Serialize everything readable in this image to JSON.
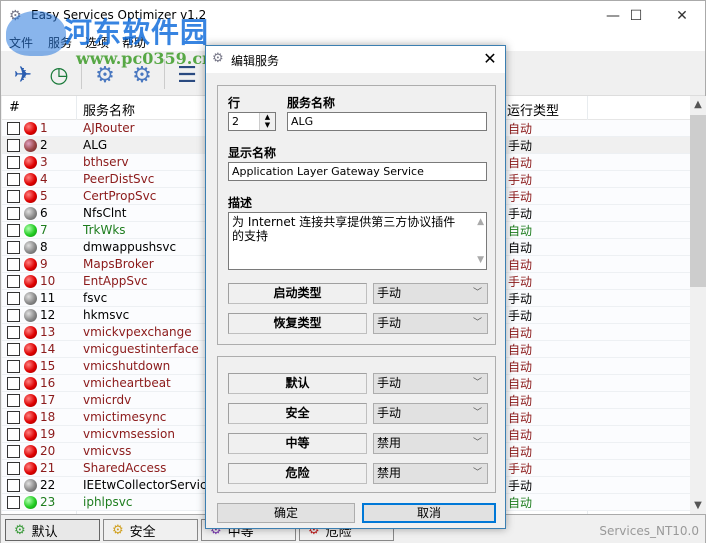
{
  "window": {
    "title": "Easy Services Optimizer v1.2",
    "controls": {
      "minimize": "─",
      "maximize": "☐",
      "close": "✕"
    }
  },
  "watermark": {
    "title": "河东软件园",
    "url": "www.pc0359.cn"
  },
  "menu": [
    "文件",
    "服务",
    "选项",
    "帮助"
  ],
  "toolbar": {
    "buttons": [
      {
        "name": "optimize",
        "icon": "rocket-icon",
        "glyph": "🚀"
      },
      {
        "name": "restore",
        "icon": "restore-clock-icon",
        "glyph": "🕘"
      },
      {
        "name": "start-service",
        "icon": "gear-play-icon",
        "glyph": "⚙"
      },
      {
        "name": "stop-service",
        "icon": "gear-stop-icon",
        "glyph": "⚙"
      },
      {
        "name": "add-service",
        "icon": "list-add-icon",
        "glyph": "☰"
      }
    ]
  },
  "grid": {
    "columns": {
      "num": "#",
      "name": "服务名称",
      "run_type": "运行类型"
    },
    "rows": [
      {
        "num": "1",
        "name": "AJRouter",
        "run_type": "自动",
        "status": "red",
        "color": "red",
        "rtcolor": "red"
      },
      {
        "num": "2",
        "name": "ALG",
        "run_type": "手动",
        "status": "purple",
        "color": "black",
        "rtcolor": "black",
        "selected": true
      },
      {
        "num": "3",
        "name": "bthserv",
        "run_type": "自动",
        "status": "red",
        "color": "red",
        "rtcolor": "red"
      },
      {
        "num": "4",
        "name": "PeerDistSvc",
        "run_type": "手动",
        "status": "red",
        "color": "red",
        "rtcolor": "red"
      },
      {
        "num": "5",
        "name": "CertPropSvc",
        "run_type": "手动",
        "status": "red",
        "color": "red",
        "rtcolor": "red"
      },
      {
        "num": "6",
        "name": "NfsClnt",
        "run_type": "手动",
        "status": "gray",
        "color": "black",
        "rtcolor": "black"
      },
      {
        "num": "7",
        "name": "TrkWks",
        "run_type": "自动",
        "status": "green",
        "color": "green",
        "rtcolor": "green"
      },
      {
        "num": "8",
        "name": "dmwappushsvc",
        "run_type": "自动",
        "status": "gray",
        "color": "black",
        "rtcolor": "black"
      },
      {
        "num": "9",
        "name": "MapsBroker",
        "run_type": "自动",
        "status": "red",
        "color": "red",
        "rtcolor": "red"
      },
      {
        "num": "10",
        "name": "EntAppSvc",
        "run_type": "手动",
        "status": "red",
        "color": "red",
        "rtcolor": "red"
      },
      {
        "num": "11",
        "name": "fsvc",
        "run_type": "手动",
        "status": "gray",
        "color": "black",
        "rtcolor": "black"
      },
      {
        "num": "12",
        "name": "hkmsvc",
        "run_type": "手动",
        "status": "gray",
        "color": "black",
        "rtcolor": "black"
      },
      {
        "num": "13",
        "name": "vmickvpexchange",
        "run_type": "自动",
        "status": "red",
        "color": "red",
        "rtcolor": "red"
      },
      {
        "num": "14",
        "name": "vmicguestinterface",
        "run_type": "自动",
        "status": "red",
        "color": "red",
        "rtcolor": "red"
      },
      {
        "num": "15",
        "name": "vmicshutdown",
        "run_type": "自动",
        "status": "red",
        "color": "red",
        "rtcolor": "red"
      },
      {
        "num": "16",
        "name": "vmicheartbeat",
        "run_type": "自动",
        "status": "red",
        "color": "red",
        "rtcolor": "red"
      },
      {
        "num": "17",
        "name": "vmicrdv",
        "run_type": "自动",
        "status": "red",
        "color": "red",
        "rtcolor": "red"
      },
      {
        "num": "18",
        "name": "vmictimesync",
        "run_type": "自动",
        "status": "red",
        "color": "red",
        "rtcolor": "red"
      },
      {
        "num": "19",
        "name": "vmicvmsession",
        "run_type": "自动",
        "status": "red",
        "color": "red",
        "rtcolor": "red"
      },
      {
        "num": "20",
        "name": "vmicvss",
        "run_type": "自动",
        "status": "red",
        "color": "red",
        "rtcolor": "red"
      },
      {
        "num": "21",
        "name": "SharedAccess",
        "run_type": "手动",
        "status": "red",
        "color": "red",
        "rtcolor": "red"
      },
      {
        "num": "22",
        "name": "IEEtwCollectorService",
        "run_type": "手动",
        "status": "gray",
        "color": "black",
        "rtcolor": "black"
      },
      {
        "num": "23",
        "name": "iphlpsvc",
        "run_type": "自动",
        "status": "green",
        "color": "green",
        "rtcolor": "green"
      }
    ]
  },
  "bottom_tabs": [
    {
      "label": "默认",
      "icon": "gear-green-icon",
      "active": true
    },
    {
      "label": "安全",
      "icon": "gear-yellow-icon",
      "active": false
    },
    {
      "label": "中等",
      "icon": "gear-purple-icon",
      "active": false
    },
    {
      "label": "危险",
      "icon": "gear-red-icon",
      "active": false
    }
  ],
  "status_text": "Services_NT10.0",
  "colors": {
    "red_text": "#8b1a1a",
    "green_text": "#1e7d1e",
    "accent": "#0078d7",
    "dialog_border": "#3c7fb1"
  },
  "dialog": {
    "title": "编辑服务",
    "close": "✕",
    "row_label": "行",
    "row_value": "2",
    "service_name_label": "服务名称",
    "service_name_value": "ALG",
    "display_name_label": "显示名称",
    "display_name_value": "Application Layer Gateway Service",
    "description_label": "描述",
    "description_value": "为 Internet 连接共享提供第三方协议插件的支持",
    "startup_type_label": "启动类型",
    "startup_type_value": "手动",
    "recovery_type_label": "恢复类型",
    "recovery_type_value": "手动",
    "profiles": [
      {
        "label": "默认",
        "value": "手动"
      },
      {
        "label": "安全",
        "value": "手动"
      },
      {
        "label": "中等",
        "value": "禁用"
      },
      {
        "label": "危险",
        "value": "禁用"
      }
    ],
    "ok_label": "确定",
    "cancel_label": "取消"
  }
}
